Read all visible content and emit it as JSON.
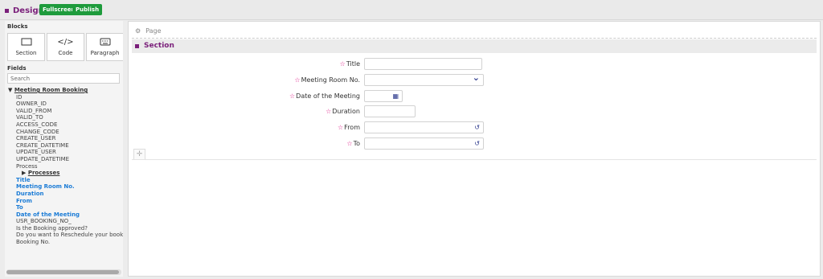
{
  "header": {
    "title": "Design",
    "fullscreen_label": "Fullscreen",
    "publish_label": "Publish"
  },
  "sidebar": {
    "blocks_heading": "Blocks",
    "blocks": [
      {
        "icon": "section-icon",
        "label": "Section"
      },
      {
        "icon": "code-icon",
        "label": "Code"
      },
      {
        "icon": "keyboard-icon",
        "label": "Paragraph"
      }
    ],
    "fields_heading": "Fields",
    "search_placeholder": "Search",
    "tree_root": "Meeting Room Booking",
    "fields_a": [
      "ID",
      "OWNER_ID",
      "VALID_FROM",
      "VALID_TO",
      "ACCESS_CODE",
      "CHANGE_CODE",
      "CREATE_USER",
      "CREATE_DATETIME",
      "UPDATE_USER",
      "UPDATE_DATETIME",
      "Process"
    ],
    "processes": "Processes",
    "fields_blue": [
      "Title",
      "Meeting Room No.",
      "Duration",
      "From",
      "To",
      "Date of the Meeting"
    ],
    "fields_b": [
      "USR_BOOKING_NO_",
      "Is the Booking approved?",
      "Do you want to Reschedule your booking?",
      "Booking No."
    ]
  },
  "main": {
    "breadcrumb": "Page",
    "section_title": "Section",
    "fields": [
      {
        "label": "Title",
        "type": "text",
        "icon": ""
      },
      {
        "label": "Meeting Room No.",
        "type": "select",
        "icon": "chevron-down-icon"
      },
      {
        "label": "Date of the Meeting",
        "type": "date",
        "icon": "calendar-icon"
      },
      {
        "label": "Duration",
        "type": "number",
        "icon": ""
      },
      {
        "label": "From",
        "type": "time",
        "icon": "clock-icon"
      },
      {
        "label": "To",
        "type": "time",
        "icon": "clock-icon"
      }
    ]
  },
  "colors": {
    "brand": "#7a1f7a",
    "button": "#1e9b3c",
    "required": "#e0288e",
    "link": "#1c7cd6"
  }
}
